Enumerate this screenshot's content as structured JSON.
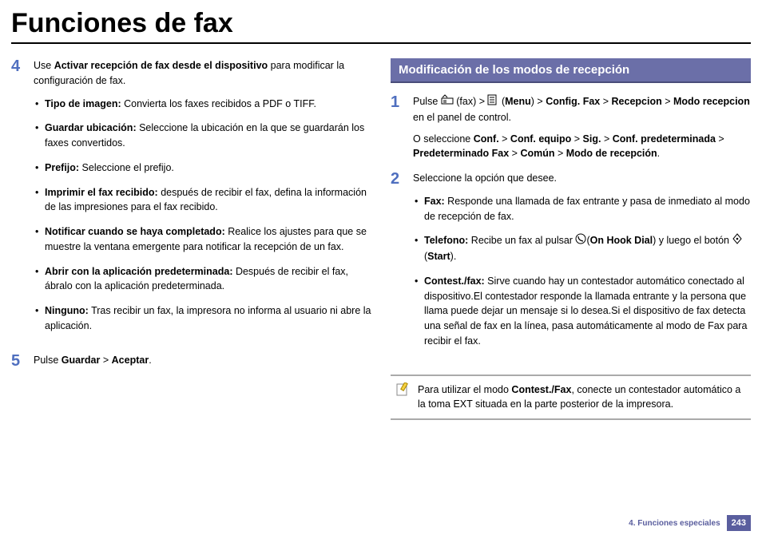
{
  "title": "Funciones de fax",
  "left": {
    "step4": {
      "num": "4",
      "intro_a": "Use ",
      "intro_b": "Activar recepción de fax desde el dispositivo",
      "intro_c": " para modificar la configuración de fax.",
      "items": [
        {
          "k": "Tipo de imagen:",
          "v": " Convierta los faxes recibidos a PDF o TIFF."
        },
        {
          "k": "Guardar ubicación:",
          "v": " Seleccione la ubicación en la que se guardarán los faxes convertidos."
        },
        {
          "k": "Prefijo:",
          "v": " Seleccione el prefijo."
        },
        {
          "k": "Imprimir el fax recibido:",
          "v": " después de recibir el fax, defina la información de las impresiones para el fax recibido."
        },
        {
          "k": "Notificar cuando se haya completado:",
          "v": " Realice los ajustes para que se muestre la ventana emergente para notificar la recepción de un fax."
        },
        {
          "k": "Abrir con la aplicación predeterminada:",
          "v": " Después de recibir el fax, ábralo con la aplicación predeterminada."
        },
        {
          "k": "Ninguno:",
          "v": " Tras recibir un fax, la impresora no informa al usuario ni abre la aplicación."
        }
      ]
    },
    "step5": {
      "num": "5",
      "a": "Pulse ",
      "b": "Guardar",
      "c": " > ",
      "d": "Aceptar",
      "e": "."
    }
  },
  "right": {
    "section_title": "Modificación de los modos de recepción",
    "step1": {
      "num": "1",
      "line1_a": "Pulse ",
      "line1_b": " (fax) > ",
      "line1_c": " (",
      "line1_menu": "Menu",
      "line1_d": ") > ",
      "line1_e": "Config. Fax",
      "line1_f": " > ",
      "line1_g": "Recepcion",
      "line1_h": " > ",
      "line1_i": "Modo recepcion",
      "line1_j": " en el panel de control.",
      "line2_a": "O seleccione ",
      "line2_b": "Conf.",
      "line2_c": " > ",
      "line2_d": "Conf. equipo",
      "line2_e": " > ",
      "line2_f": "Sig.",
      "line2_g": " > ",
      "line2_h": "Conf. predeterminada",
      "line2_i": " > ",
      "line2_j": "Predeterminado Fax",
      "line2_k": " > ",
      "line2_l": "Común ",
      "line2_m": " > ",
      "line2_n": "Modo de recepción",
      "line2_o": "."
    },
    "step2": {
      "num": "2",
      "intro": "Seleccione la opción que desee.",
      "fax_k": "Fax:",
      "fax_v": " Responde una llamada de fax entrante y pasa de inmediato al modo de recepción de fax.",
      "tel_k": "Telefono:",
      "tel_a": " Recibe un fax al pulsar ",
      "tel_b": "(",
      "tel_c": "On Hook Dial",
      "tel_d": ") y luego el botón ",
      "tel_e": " (",
      "tel_f": "Start",
      "tel_g": ").",
      "con_k": "Contest./fax:",
      "con_v": " Sirve cuando hay un contestador automático conectado al dispositivo.El contestador responde la llamada entrante y la persona que llama puede dejar un mensaje si lo desea.Si el dispositivo de fax detecta una señal de fax en la línea, pasa automáticamente al modo de Fax para recibir el fax."
    },
    "note": {
      "a": "Para utilizar el modo ",
      "b": "Contest./Fax",
      "c": ", conecte un contestador automático a la toma EXT situada en la parte posterior de la impresora."
    }
  },
  "footer": {
    "chapter": "4.  Funciones especiales",
    "page": "243"
  }
}
